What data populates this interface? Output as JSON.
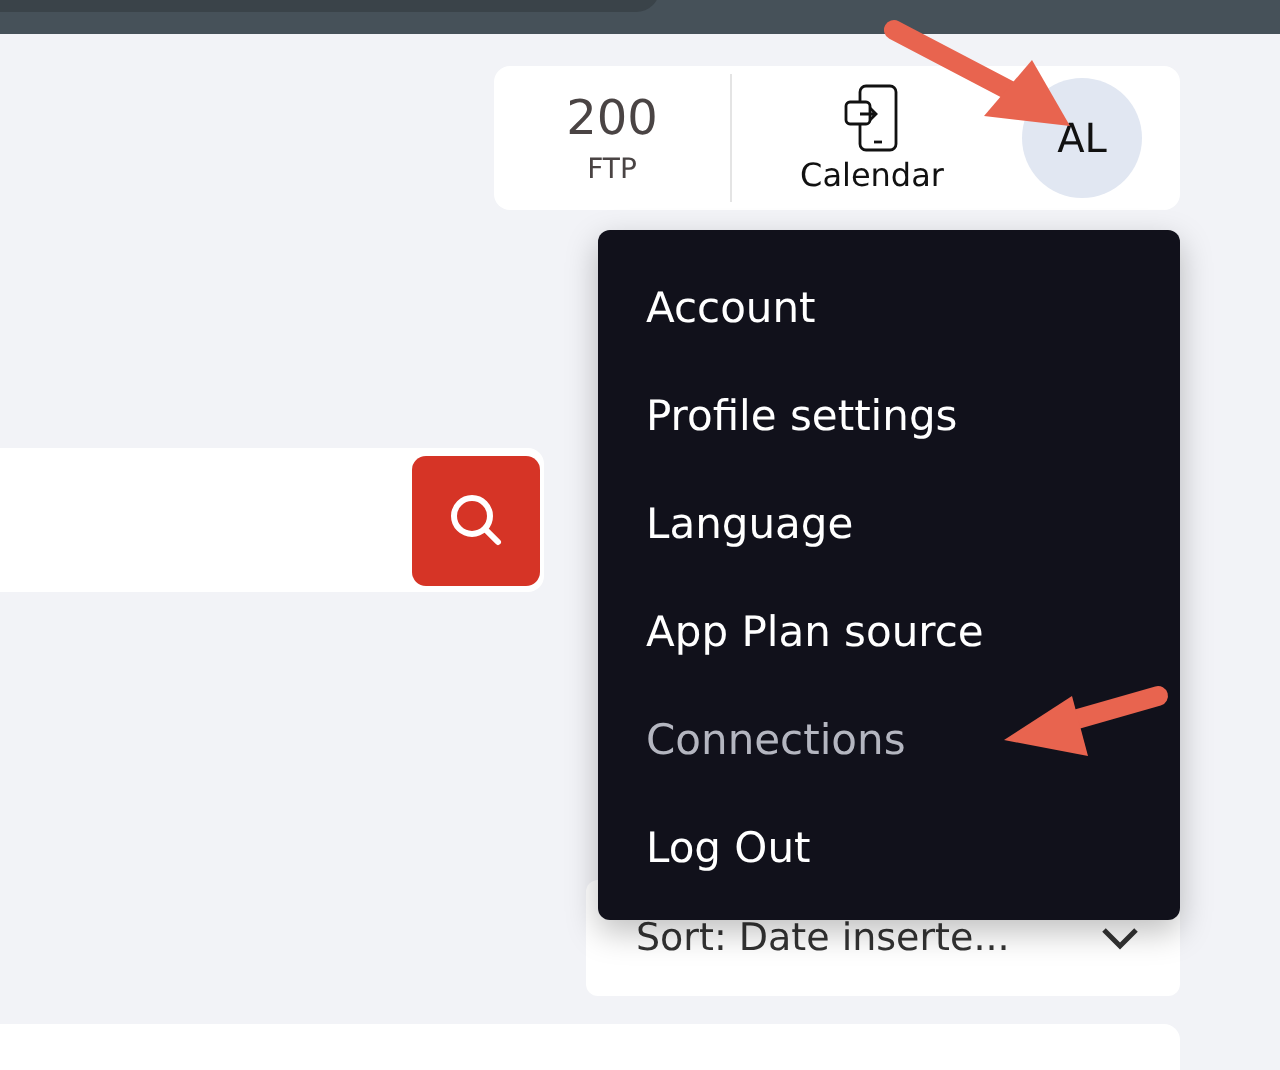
{
  "header": {
    "ftp": {
      "value": "200",
      "label": "FTP"
    },
    "calendar": {
      "label": "Calendar"
    },
    "avatar": {
      "initials": "AL"
    }
  },
  "account_menu": {
    "items": [
      {
        "label": "Account",
        "selected": false
      },
      {
        "label": "Profile settings",
        "selected": false
      },
      {
        "label": "Language",
        "selected": false
      },
      {
        "label": "App Plan source",
        "selected": false
      },
      {
        "label": "Connections",
        "selected": true
      },
      {
        "label": "Log Out",
        "selected": false
      }
    ]
  },
  "sort": {
    "label": "Sort: Date inserte..."
  }
}
